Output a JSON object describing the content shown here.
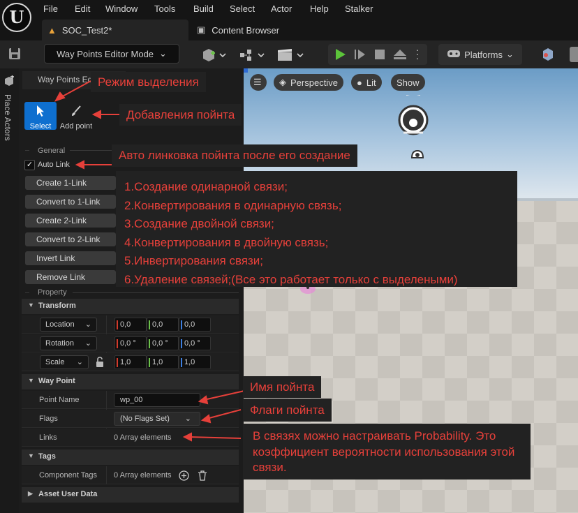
{
  "menu": [
    "File",
    "Edit",
    "Window",
    "Tools",
    "Build",
    "Select",
    "Actor",
    "Help",
    "Stalker"
  ],
  "logo_letter": "U",
  "tabs": {
    "level": "SOC_Test2*",
    "content_browser": "Content Browser"
  },
  "toolbar": {
    "mode": "Way Points Editor Mode",
    "platforms": "Platforms"
  },
  "left_strip": {
    "place_actors": "Place Actors"
  },
  "panel": {
    "tab_title": "Way Points Edi",
    "modes": {
      "select": "Select",
      "add_point": "Add point"
    },
    "general_label": "General",
    "auto_link": {
      "label": "Auto Link",
      "checked": true
    },
    "buttons": [
      "Create 1-Link",
      "Convert to 1-Link",
      "Create 2-Link",
      "Convert to 2-Link",
      "Invert Link",
      "Remove Link"
    ],
    "property_label": "Property",
    "transform": {
      "header": "Transform",
      "rows": [
        {
          "label": "Location",
          "values": [
            "0,0",
            "0,0",
            "0,0"
          ]
        },
        {
          "label": "Rotation",
          "values": [
            "0,0 °",
            "0,0 °",
            "0,0 °"
          ]
        },
        {
          "label": "Scale",
          "values": [
            "1,0",
            "1,0",
            "1,0"
          ]
        }
      ]
    },
    "way_point": {
      "header": "Way Point",
      "point_name_label": "Point Name",
      "point_name_value": "wp_00",
      "flags_label": "Flags",
      "flags_value": "(No Flags Set)",
      "links_label": "Links",
      "links_value": "0 Array elements"
    },
    "tags": {
      "header": "Tags",
      "component_tags_label": "Component Tags",
      "component_tags_value": "0 Array elements"
    },
    "asset_user_data": "Asset User Data"
  },
  "viewport": {
    "perspective": "Perspective",
    "lit": "Lit",
    "show": "Show"
  },
  "annotations": {
    "select_mode": "Режим выделения",
    "add_point": "Добавления пойнта",
    "auto_link": "Авто линковка пойнта после его создание",
    "links_list": [
      "1.Создание одинарной связи;",
      "2.Конвертирования в одинарную связь;",
      "3.Создание двойной связи;",
      "4.Конвертирования в двойную связь;",
      "5.Инвертирования связи;",
      "6.Удаление связей;(Все это работает только с выделеными)"
    ],
    "point_name": "Имя пойнта",
    "flags": "Флаги пойнта",
    "probability": "В связях можно настраивать Probability. Это коэффициент вероятности использования этой связи."
  },
  "colors": {
    "accent": "#0e6fcf",
    "annotation_text": "#e6403a",
    "annotation_bg": "#222222"
  }
}
